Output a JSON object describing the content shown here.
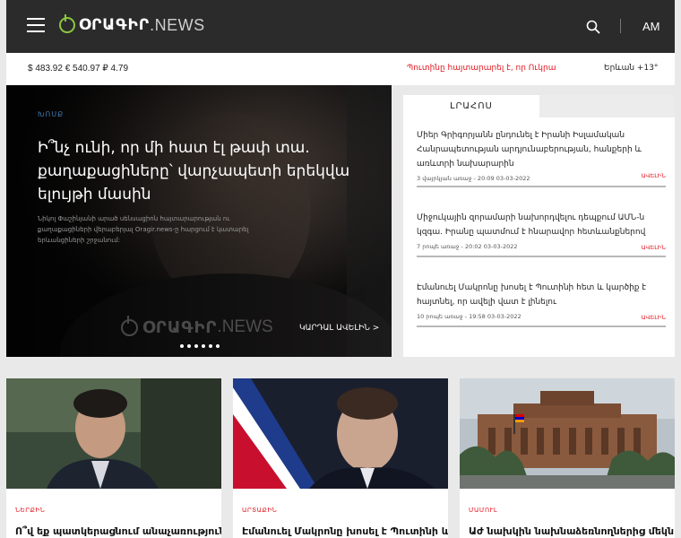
{
  "header": {
    "logo_text": "ՕՐԱԳԻՐ",
    "logo_suffix": ".NEWS",
    "language": "AM",
    "icons": [
      "menu-icon",
      "search-icon"
    ]
  },
  "ticker": {
    "rates": "$ 483.92 € 540.97 ₽ 4.79",
    "headline": "Պուտինը հայտարարել է, որ Ուկրա",
    "weather": "Երևան +13°"
  },
  "hero": {
    "category": "ԽՈՍՔ",
    "title": "Ի՞նչ ունի, որ մի հատ էլ թափ տա. քաղաքացիները՝ վարչապետի երեկվա ելույթի մասին",
    "description": "Նիկոլ Փաշինյանի արած սենսացիոն հայտարարության ու քաղաքացիների վերաբերյալ Oragir.news-ը հարցում է կատարել երևանցիների շրջանում:",
    "watermark_text": "ՕՐԱԳԻՐ",
    "watermark_suffix": ".NEWS",
    "read_more": "ԿԱՐԴԱԼ ԱՎԵԼԻՆ >",
    "slide_count": 6
  },
  "news_panel": {
    "tab_label": "ԼՐԱՀՈՍ",
    "items": [
      {
        "title": "Միեր Գրիգորյանն ընդունել է Իրանի Իսլամական Հանրապետության արդյունաբերության, հանքերի և առևտրի նախարարին",
        "meta": "3 վայրկյան առաջ - 20:09 03-03-2022",
        "more": "ԱՎԵԼԻՆ"
      },
      {
        "title": "Միջուկային զորամարի նախորդվելու դեպքում ԱՄՆ-ն կզգա. Իրանը պատմում է հնարավոր հետևանքներով",
        "meta": "7 րոպե առաջ - 20:02 03-03-2022",
        "more": "ԱՎԵԼԻՆ"
      },
      {
        "title": "Էմանուել Մակրոնը խոսել է Պուտինի հետ և կարծիք է հայտնել, որ ավելի վատ է լինելու",
        "meta": "10 րոպե առաջ - 19:58 03-03-2022",
        "more": "ԱՎԵԼԻՆ"
      }
    ]
  },
  "cards": [
    {
      "category": "ՆԵՐՔԻՆ",
      "title": "Ո՞վ եք պատկերացնում անաչառությունը,"
    },
    {
      "category": "ԱՐՏԱՔԻՆ",
      "title": "Էմանուել Մակրոնը խոսել է Պուտինի և"
    },
    {
      "category": "ՄԱՄՈՒԼ",
      "title": "Աժ նախկին նախնաձեռնողներից մեկն"
    }
  ]
}
